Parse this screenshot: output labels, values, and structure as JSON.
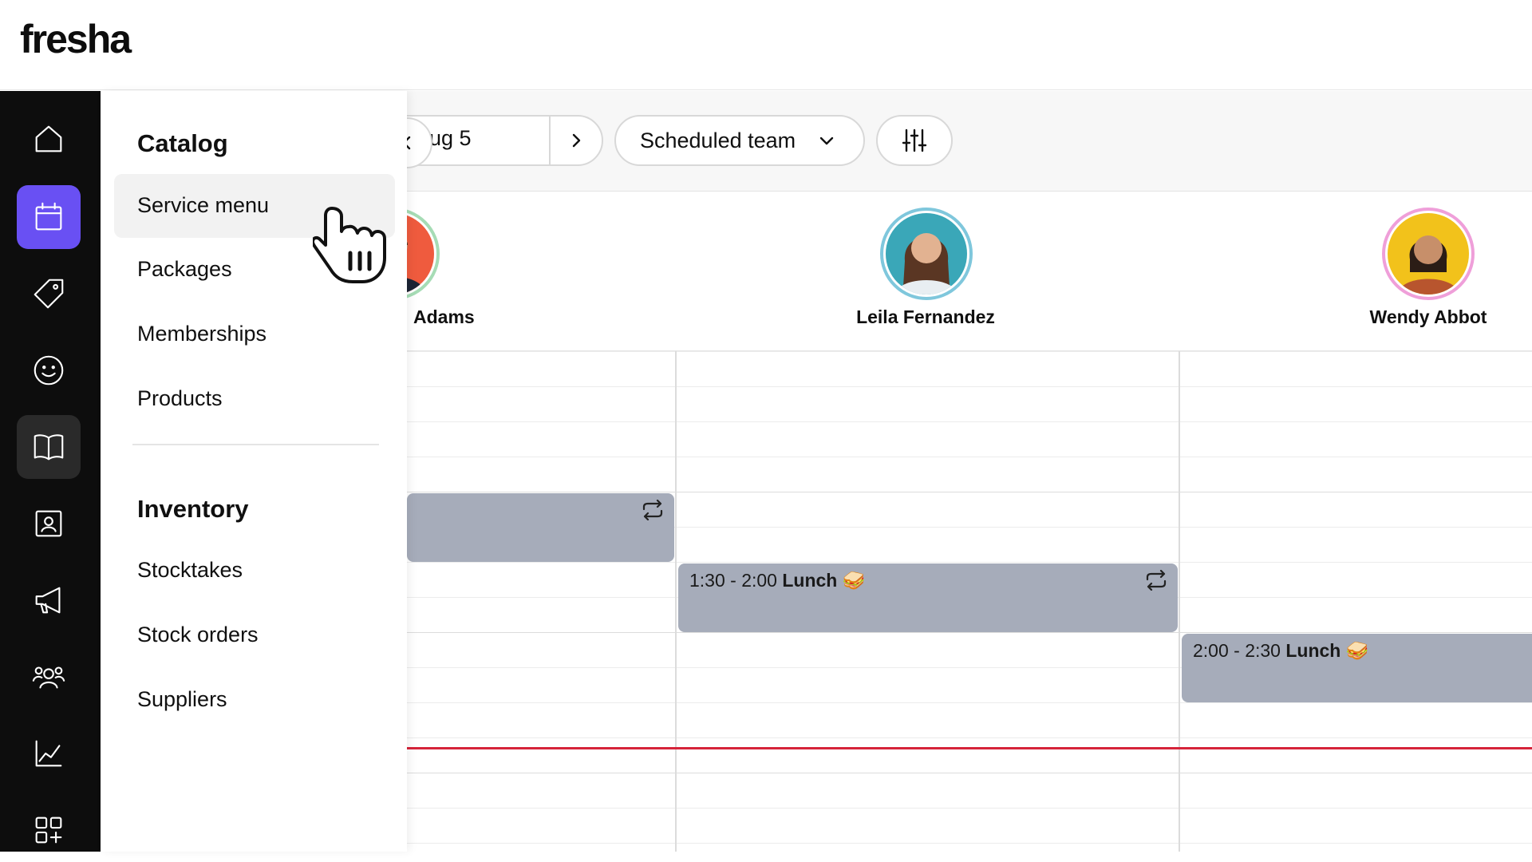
{
  "app": {
    "logo": "fresha"
  },
  "rail": {
    "items": [
      {
        "icon": "home-icon"
      },
      {
        "icon": "calendar-icon",
        "active": true
      },
      {
        "icon": "tag-icon"
      },
      {
        "icon": "smiley-icon"
      },
      {
        "icon": "book-icon",
        "hover": true
      },
      {
        "icon": "contact-card-icon"
      },
      {
        "icon": "megaphone-icon"
      },
      {
        "icon": "team-icon"
      },
      {
        "icon": "chart-icon"
      },
      {
        "icon": "apps-add-icon"
      }
    ]
  },
  "catalog_menu": {
    "catalog_title": "Catalog",
    "catalog_items": [
      "Service menu",
      "Packages",
      "Memberships",
      "Products"
    ],
    "inventory_title": "Inventory",
    "inventory_items": [
      "Stocktakes",
      "Stock orders",
      "Suppliers"
    ]
  },
  "toolbar": {
    "date_text": "ug 5",
    "team_select": "Scheduled team"
  },
  "staff": [
    {
      "name": "Adams",
      "ring": "#a6dcb5",
      "bg": "#ef5b3e"
    },
    {
      "name": "Leila Fernandez",
      "ring": "#7fc7dc",
      "bg": "#3aa7b8"
    },
    {
      "name": "Wendy Abbot",
      "ring": "#ef9fd9",
      "bg": "#f2c21b"
    }
  ],
  "events": [
    {
      "time": "",
      "title": ""
    },
    {
      "time": "1:30 - 2:00",
      "title": "Lunch"
    },
    {
      "time": "2:00 - 2:30",
      "title": "Lunch"
    }
  ],
  "colors": {
    "accent": "#6950f3",
    "now_line": "#d6243a",
    "event_bg": "#a6acba"
  }
}
